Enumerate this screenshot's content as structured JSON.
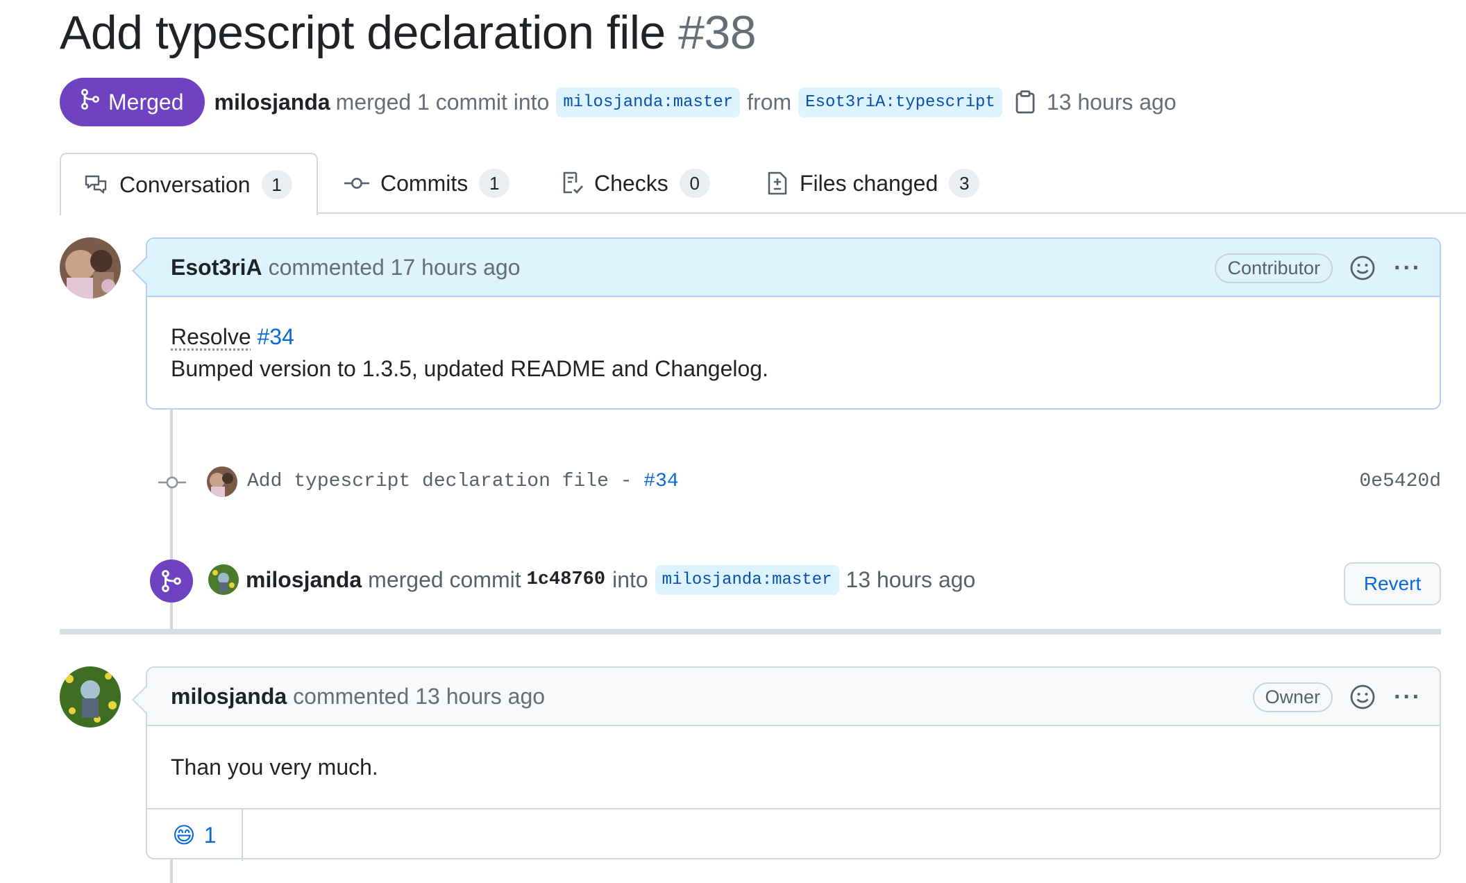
{
  "pr": {
    "title": "Add typescript declaration file",
    "number": "#38",
    "status": "Merged",
    "author": "milosjanda",
    "merged_text": "merged 1 commit into",
    "base_branch": "milosjanda:master",
    "from_text": "from",
    "head_branch": "Esot3riA:typescript",
    "time": "13 hours ago"
  },
  "tabs": [
    {
      "label": "Conversation",
      "count": "1",
      "icon": "conversation-icon"
    },
    {
      "label": "Commits",
      "count": "1",
      "icon": "commit-icon"
    },
    {
      "label": "Checks",
      "count": "0",
      "icon": "checklist-icon"
    },
    {
      "label": "Files changed",
      "count": "3",
      "icon": "file-diff-icon"
    }
  ],
  "comment1": {
    "author": "Esot3riA",
    "meta": "commented 17 hours ago",
    "role": "Contributor",
    "resolve": "Resolve",
    "issue_link": "#34",
    "line2": "Bumped version to 1.3.5, updated README and Changelog."
  },
  "commit": {
    "message": "Add typescript declaration file - ",
    "issue_link": "#34",
    "sha": "0e5420d"
  },
  "merge_event": {
    "author": "milosjanda",
    "text": "merged commit",
    "sha": "1c48760",
    "into": "into",
    "branch": "milosjanda:master",
    "time": "13 hours ago",
    "revert_label": "Revert"
  },
  "comment2": {
    "author": "milosjanda",
    "meta": "commented 13 hours ago",
    "role": "Owner",
    "body": "Than you very much.",
    "reaction_emoji": "😄",
    "reaction_count": "1"
  },
  "colors": {
    "merged_purple": "#6f42c1",
    "link_blue": "#0969da",
    "header_blue": "#ddf4ff"
  }
}
